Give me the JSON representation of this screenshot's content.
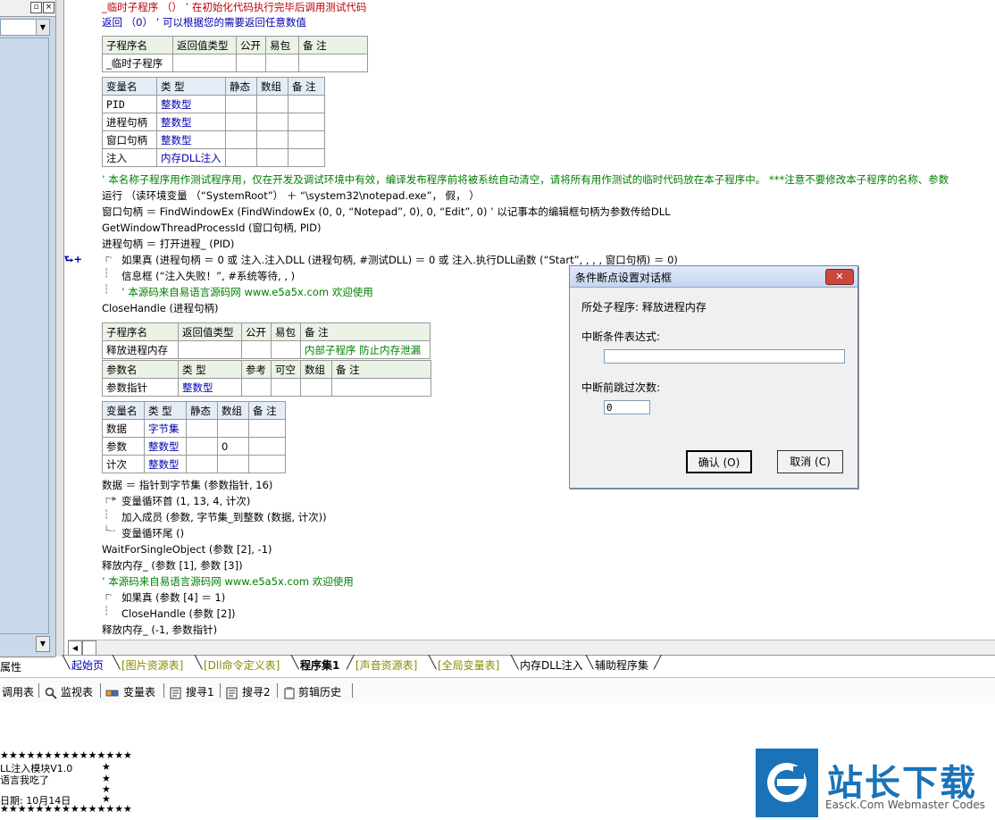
{
  "left_pane": {
    "tab_label": "属性"
  },
  "code": {
    "lines": {
      "l1": "_临时子程序 （）  ’ 在初始化代码执行完毕后调用测试代码",
      "l2": "返回 （0）  ’ 可以根据您的需要返回任意数值",
      "c1": "’ 本名称子程序用作测试程序用，仅在开发及调试环境中有效，编译发布程序前将被系统自动清空，请将所有用作测试的临时代码放在本子程序中。 ***注意不要修改本子程序的名称、参数",
      "c2": "运行 （读环境变量 （“SystemRoot”） ＋ “\\system32\\notepad.exe”， 假， ）",
      "c3": "窗口句柄 ＝ FindWindowEx (FindWindowEx (0, 0, “Notepad”, 0), 0, “Edit”, 0)  ’ 以记事本的编辑框句柄为参数传给DLL",
      "c4": "GetWindowThreadProcessId (窗口句柄, PID)",
      "c5": "进程句柄 ＝ 打开进程_ (PID)",
      "c6": "如果真 (进程句柄 ＝ 0 或 注入.注入DLL (进程句柄, #测试DLL) ＝ 0 或 注入.执行DLL函数 (“Start”, , , , 窗口句柄) ＝ 0)",
      "c7": "信息框 (“注入失败！”, #系统等待, , )",
      "c8": "’ 本源码来自易语言源码网 www.e5a5x.com  欢迎使用",
      "c9": "CloseHandle (进程句柄)",
      "d1": "数据 ＝ 指针到字节集 (参数指针, 16)",
      "d2": "变量循环首 (1, 13, 4, 计次)",
      "d3": "加入成员 (参数, 字节集_到整数 (数据, 计次))",
      "d4": "变量循环尾 ()",
      "d5": "WaitForSingleObject (参数 [2], -1)",
      "d6": "释放内存_ (参数 [1], 参数 [3])",
      "d7": "’ 本源码来自易语言源码网 www.e5a5x.com  欢迎使用",
      "d8": "如果真 (参数 [4] ＝ 1)",
      "d9": "CloseHandle (参数 [2])",
      "d10": "释放内存_ (-1, 参数指针)"
    },
    "gutter_mark": "⮑+",
    "table1": {
      "headers": [
        "子程序名",
        "返回值类型",
        "公开",
        "易包",
        "备 注"
      ],
      "row": [
        "_临时子程序",
        "",
        "",
        "",
        ""
      ]
    },
    "table2": {
      "headers": [
        "变量名",
        "类 型",
        "静态",
        "数组",
        "备 注"
      ],
      "rows": [
        [
          "PID",
          "整数型",
          "",
          "",
          ""
        ],
        [
          "进程句柄",
          "整数型",
          "",
          "",
          ""
        ],
        [
          "窗口句柄",
          "整数型",
          "",
          "",
          ""
        ],
        [
          "注入",
          "内存DLL注入",
          "",
          "",
          ""
        ]
      ]
    },
    "table3": {
      "headers": [
        "子程序名",
        "返回值类型",
        "公开",
        "易包",
        "备 注"
      ],
      "row": [
        "释放进程内存",
        "",
        "",
        "",
        "内部子程序 防止内存泄漏"
      ],
      "param_headers": [
        "参数名",
        "类 型",
        "参考",
        "可空",
        "数组",
        "备 注"
      ],
      "param_row": [
        "参数指针",
        "整数型",
        "",
        "",
        "",
        ""
      ]
    },
    "table4": {
      "headers": [
        "变量名",
        "类 型",
        "静态",
        "数组",
        "备 注"
      ],
      "rows": [
        [
          "数据",
          "字节集",
          "",
          "",
          ""
        ],
        [
          "参数",
          "整数型",
          "",
          "0",
          ""
        ],
        [
          "计次",
          "整数型",
          "",
          "",
          ""
        ]
      ]
    }
  },
  "tabs": [
    {
      "label": "起始页",
      "style": "blue"
    },
    {
      "label": "[图片资源表]",
      "style": "olive"
    },
    {
      "label": "[Dll命令定义表]",
      "style": "olive"
    },
    {
      "label": "程序集1",
      "style": "bold"
    },
    {
      "label": "[声音资源表]",
      "style": "olive"
    },
    {
      "label": "[全局变量表]",
      "style": "olive"
    },
    {
      "label": "内存DLL注入",
      "style": "normal"
    },
    {
      "label": "辅助程序集",
      "style": "normal"
    }
  ],
  "toolbar": {
    "call_table": "调用表",
    "watch_table": "监视表",
    "var_table": "变量表",
    "search1": "搜寻1",
    "search2": "搜寻2",
    "clip_history": "剪辑历史"
  },
  "output": {
    "stars_top": "★★★★★★★★★★★★★★★",
    "line1": "LL注入模块V1.0",
    "line2": "语言我吃了",
    "line3": "日期: 10月14日",
    "stars_bottom": "★★★★★★★★★★★★★★★",
    "star": "★"
  },
  "logo": {
    "cn": "站长下载",
    "en": "Easck.Com Webmaster Codes"
  },
  "dialog": {
    "title": "条件断点设置对话框",
    "close": "✕",
    "subroutine_label": "所处子程序: 释放进程内存",
    "cond_label": "中断条件表达式:",
    "cond_value": "",
    "skip_label": "中断前跳过次数:",
    "skip_value": "0",
    "ok_label": "确认 (O)",
    "cancel_label": "取消 (C)"
  },
  "colors": {
    "comment": "#008000",
    "type_blue": "#0000b0",
    "tab_olive": "#8a8a00",
    "logo_blue": "#1a73b8"
  }
}
